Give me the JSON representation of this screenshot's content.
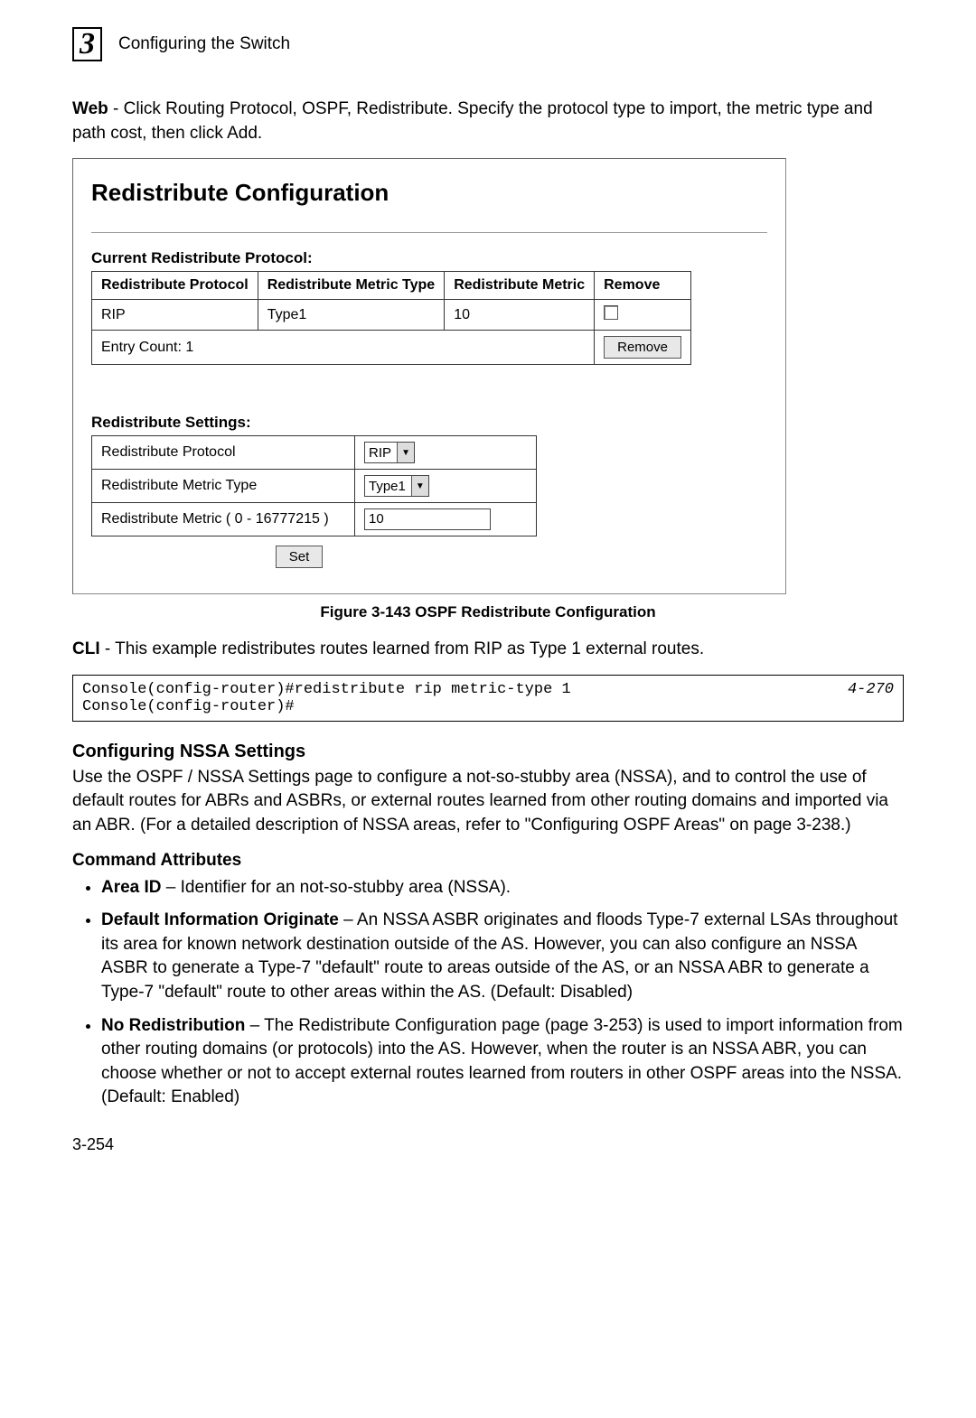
{
  "header": {
    "chapter_number": "3",
    "chapter_title": "Configuring the Switch"
  },
  "intro": {
    "web_label": "Web",
    "web_text": " - Click Routing Protocol, OSPF, Redistribute. Specify the protocol type to import, the metric type and path cost, then click Add."
  },
  "screenshot": {
    "title": "Redistribute Configuration",
    "current_heading": "Current Redistribute Protocol:",
    "table": {
      "headers": [
        "Redistribute Protocol",
        "Redistribute Metric Type",
        "Redistribute Metric",
        "Remove"
      ],
      "row": {
        "protocol": "RIP",
        "metric_type": "Type1",
        "metric": "10"
      },
      "entry_count": "Entry Count: 1",
      "remove_btn": "Remove"
    },
    "settings": {
      "heading": "Redistribute Settings:",
      "rows": {
        "protocol_label": "Redistribute Protocol",
        "protocol_value": "RIP",
        "metric_type_label": "Redistribute Metric Type",
        "metric_type_value": "Type1",
        "metric_label": "Redistribute Metric ( 0 - 16777215 )",
        "metric_value": "10"
      },
      "set_btn": "Set"
    }
  },
  "figure_caption": "Figure 3-143   OSPF Redistribute Configuration",
  "cli": {
    "label": "CLI",
    "text": " - This example redistributes routes learned from RIP as Type 1 external routes.",
    "line1": "Console(config-router)#redistribute rip metric-type 1",
    "ref": "4-270",
    "line2": "Console(config-router)#"
  },
  "nssa": {
    "heading": "Configuring NSSA Settings",
    "body": "Use the OSPF / NSSA Settings page to configure a not-so-stubby area (NSSA), and to control the use of default routes for ABRs and ASBRs, or external routes learned from other routing domains and imported via an ABR. (For a detailed description of NSSA areas, refer to \"Configuring OSPF Areas\" on page 3-238.)"
  },
  "attrs": {
    "heading": "Command Attributes",
    "items": [
      {
        "term": "Area ID",
        "desc": " – Identifier for an not-so-stubby area (NSSA)."
      },
      {
        "term": "Default Information Originate",
        "desc": " – An NSSA ASBR originates and floods Type-7 external LSAs throughout its area for known network destination outside of the AS. However, you can also configure an NSSA ASBR to generate a Type-7 \"default\" route to areas outside of the AS, or an NSSA ABR to generate a Type-7 \"default\" route to other areas within the AS. (Default: Disabled)"
      },
      {
        "term": "No Redistribution",
        "desc": " – The Redistribute Configuration page (page 3-253) is used to import information from other routing domains (or protocols) into the AS. However, when the router is an NSSA ABR, you can choose whether or not to accept external routes learned from routers in other OSPF areas into the NSSA. (Default: Enabled)"
      }
    ]
  },
  "page_number": "3-254"
}
